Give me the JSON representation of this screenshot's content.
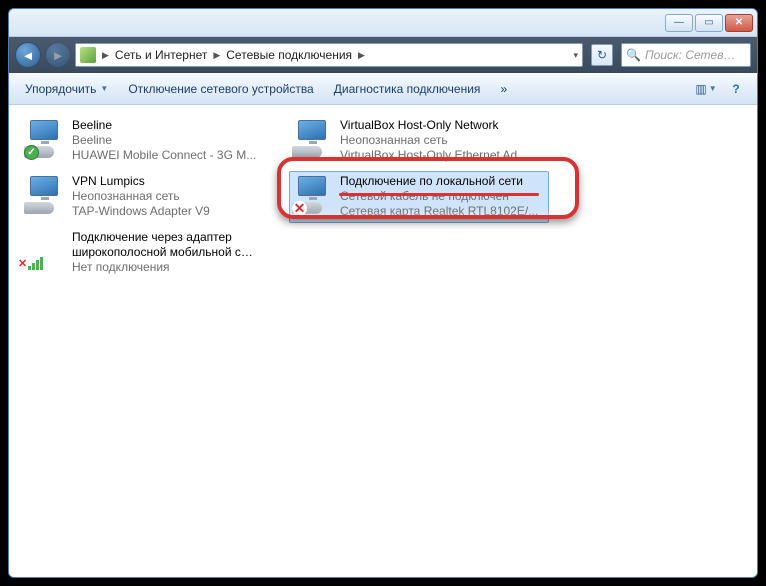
{
  "titlebar": {
    "min": "—",
    "max": "▭",
    "close": "✕"
  },
  "nav": {
    "crumbs": [
      "Сеть и Интернет",
      "Сетевые подключения"
    ],
    "refresh_glyph": "↻",
    "search_placeholder": "Поиск: Сетев…",
    "search_icon": "🔍"
  },
  "toolbar": {
    "organize": "Упорядочить",
    "disable": "Отключение сетевого устройства",
    "diag": "Диагностика подключения",
    "more": "»",
    "viewicons": "▥",
    "help": "?"
  },
  "connections": [
    {
      "name": "Beeline",
      "line2": "Beeline",
      "line3": "HUAWEI Mobile Connect - 3G M...",
      "icon": "ok"
    },
    {
      "name": "VirtualBox Host-Only Network",
      "line2": "Неопознанная сеть",
      "line3": "VirtualBox Host-Only Ethernet Ad...",
      "icon": "plain"
    },
    {
      "name": "VPN Lumpics",
      "line2": "Неопознанная сеть",
      "line3": "TAP-Windows Adapter V9",
      "icon": "plain"
    },
    {
      "name": "Подключение по локальной сети",
      "line2": "Сетевой кабель не подключен",
      "line3": "Сетевая карта Realtek RTL8102E/...",
      "icon": "x",
      "selected": true
    },
    {
      "name": "Подключение через адаптер широкополосной мобильной с…",
      "line2": "Нет подключения",
      "line3": "",
      "icon": "bars-x"
    }
  ]
}
